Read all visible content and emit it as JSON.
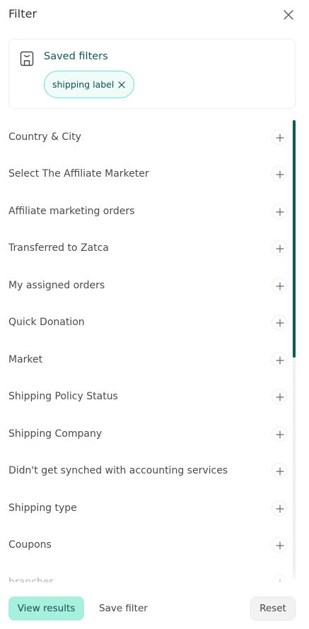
{
  "header": {
    "title": "Filter",
    "close_icon": "close-icon"
  },
  "saved_filters": {
    "title": "Saved filters",
    "icon": "bookmark-icon",
    "chips": [
      {
        "label": "shipping label",
        "remove_icon": "close-icon"
      }
    ]
  },
  "filters": [
    {
      "label": "Country & City"
    },
    {
      "label": "Select The Affiliate Marketer"
    },
    {
      "label": "Affiliate marketing orders"
    },
    {
      "label": "Transferred to Zatca"
    },
    {
      "label": "My assigned orders"
    },
    {
      "label": "Quick Donation"
    },
    {
      "label": "Market"
    },
    {
      "label": "Shipping Policy Status"
    },
    {
      "label": "Shipping Company"
    },
    {
      "label": "Didn't get synched with accounting services"
    },
    {
      "label": "Shipping type"
    },
    {
      "label": "Coupons"
    },
    {
      "label": "branches"
    }
  ],
  "footer": {
    "view_results": "View results",
    "save_filter": "Save filter",
    "reset": "Reset"
  },
  "colors": {
    "accent": "#0d5b57",
    "chip_border": "#6fe3c7",
    "chip_bg": "#effcf8",
    "primary_button": "#a8f0de",
    "reset_bg": "#f2f2f2"
  }
}
